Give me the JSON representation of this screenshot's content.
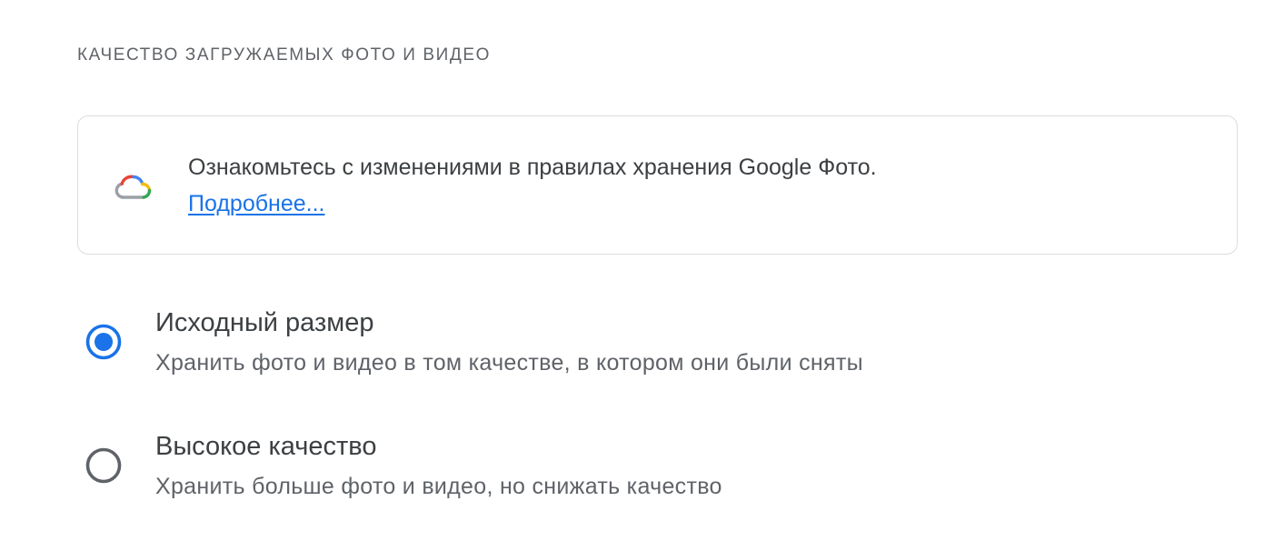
{
  "section": {
    "title": "КАЧЕСТВО ЗАГРУЖАЕМЫХ ФОТО И ВИДЕО"
  },
  "notice": {
    "icon": "google-cloud-icon",
    "text": "Ознакомьтесь с изменениями в правилах хранения Google Фото.",
    "link_label": "Подробнее..."
  },
  "options": [
    {
      "title": "Исходный размер",
      "description": "Хранить фото и видео в том качестве, в котором они были сняты",
      "selected": true
    },
    {
      "title": "Высокое качество",
      "description": "Хранить больше фото и видео, но снижать качество",
      "selected": false
    }
  ],
  "colors": {
    "accent": "#1a73e8",
    "radio_selected": "#1a73e8",
    "radio_unselected": "#5f6368",
    "card_border": "#dadce0",
    "cloud_blue": "#4285f4",
    "cloud_red": "#ea4335",
    "cloud_yellow": "#fbbc04",
    "cloud_green": "#34a853",
    "cloud_grey": "#9aa0a6"
  }
}
